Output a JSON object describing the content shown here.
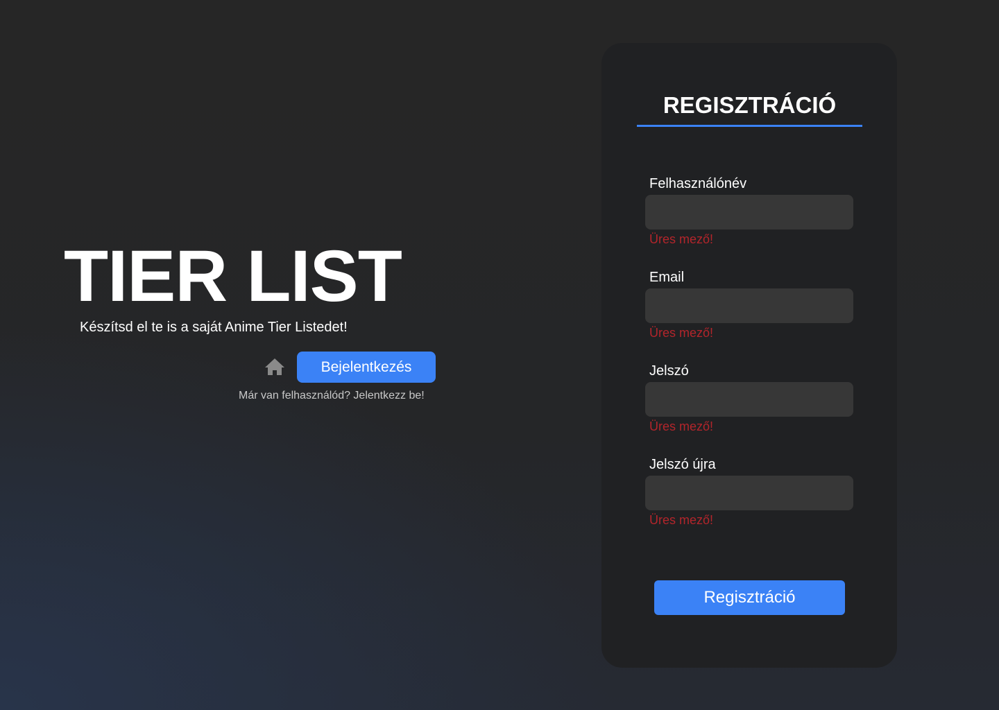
{
  "hero": {
    "title": "TIER LIST",
    "subtitle": "Készítsd el te is a saját Anime Tier Listedet!",
    "home_icon": "home-icon",
    "login_button_label": "Bejelentkezés",
    "login_hint": "Már van felhasználód? Jelentkezz be!"
  },
  "register_form": {
    "title": "REGISZTRÁCIÓ",
    "fields": [
      {
        "label": "Felhasználónév",
        "value": "",
        "error": "Üres mező!"
      },
      {
        "label": "Email",
        "value": "",
        "error": "Üres mező!"
      },
      {
        "label": "Jelszó",
        "value": "",
        "error": "Üres mező!"
      },
      {
        "label": "Jelszó újra",
        "value": "",
        "error": "Üres mező!"
      }
    ],
    "submit_label": "Regisztráció"
  },
  "colors": {
    "accent": "#3b82f6",
    "error": "#b3252b",
    "card_background": "#202123",
    "input_background": "#373737"
  }
}
